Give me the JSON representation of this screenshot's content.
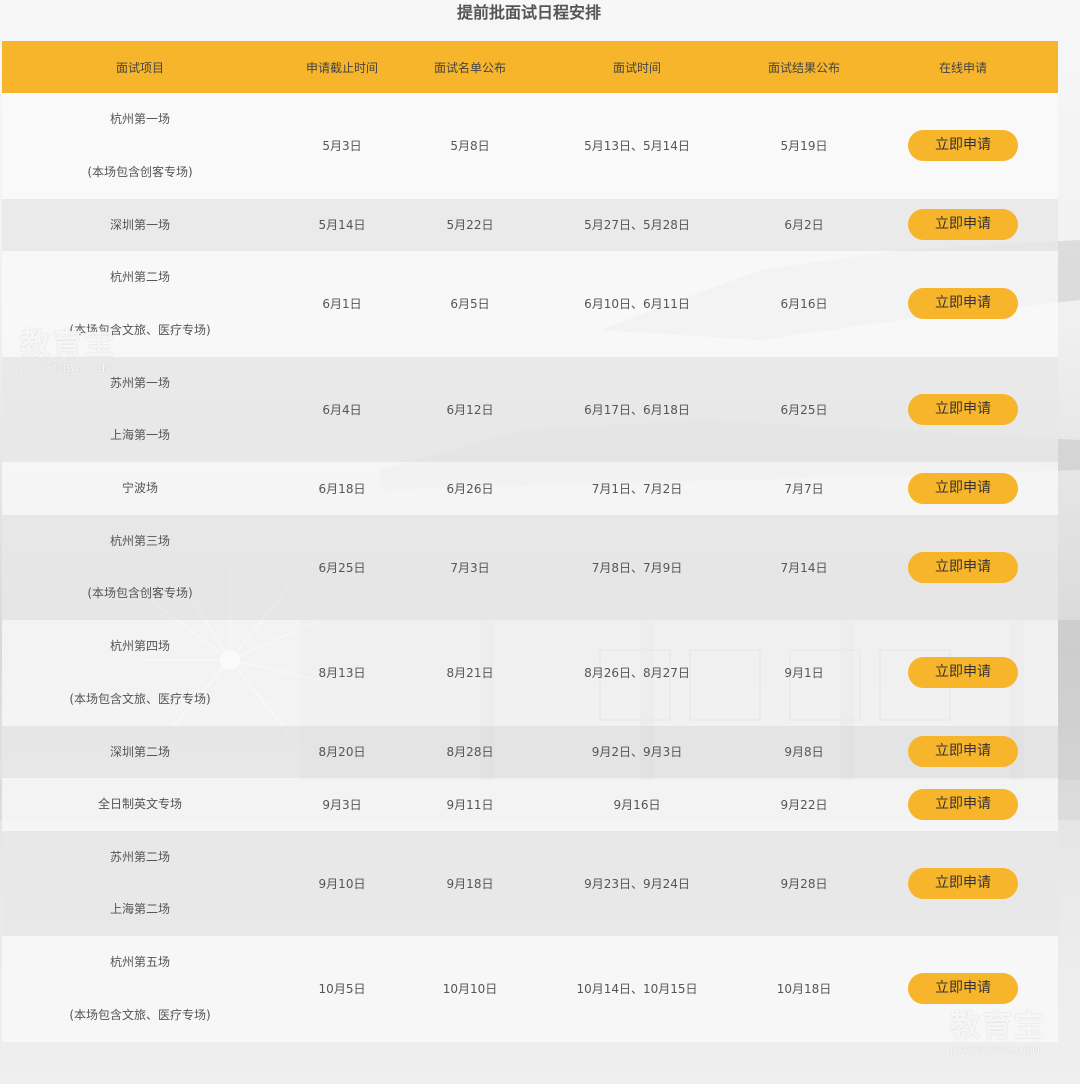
{
  "title": "提前批面试日程安排",
  "headers": [
    "面试项目",
    "申请截止时间",
    "面试名单公布",
    "面试时间",
    "面试结果公布",
    "在线申请"
  ],
  "button_label": "立即申请",
  "rows": [
    {
      "item": [
        "杭州第一场",
        "(本场包含创客专场)"
      ],
      "deadline": "5月3日",
      "list": "5月8日",
      "interview": "5月13日、5月14日",
      "result": "5月19日"
    },
    {
      "item": [
        "深圳第一场"
      ],
      "deadline": "5月14日",
      "list": "5月22日",
      "interview": "5月27日、5月28日",
      "result": "6月2日"
    },
    {
      "item": [
        "杭州第二场",
        "(本场包含文旅、医疗专场)"
      ],
      "deadline": "6月1日",
      "list": "6月5日",
      "interview": "6月10日、6月11日",
      "result": "6月16日"
    },
    {
      "item": [
        "苏州第一场",
        "上海第一场"
      ],
      "deadline": "6月4日",
      "list": "6月12日",
      "interview": "6月17日、6月18日",
      "result": "6月25日"
    },
    {
      "item": [
        "宁波场"
      ],
      "deadline": "6月18日",
      "list": "6月26日",
      "interview": "7月1日、7月2日",
      "result": "7月7日"
    },
    {
      "item": [
        "杭州第三场",
        "(本场包含创客专场)"
      ],
      "deadline": "6月25日",
      "list": "7月3日",
      "interview": "7月8日、7月9日",
      "result": "7月14日"
    },
    {
      "item": [
        "杭州第四场",
        "(本场包含文旅、医疗专场)"
      ],
      "deadline": "8月13日",
      "list": "8月21日",
      "interview": "8月26日、8月27日",
      "result": "9月1日"
    },
    {
      "item": [
        "深圳第二场"
      ],
      "deadline": "8月20日",
      "list": "8月28日",
      "interview": "9月2日、9月3日",
      "result": "9月8日"
    },
    {
      "item": [
        "全日制英文专场"
      ],
      "deadline": "9月3日",
      "list": "9月11日",
      "interview": "9月16日",
      "result": "9月22日"
    },
    {
      "item": [
        "苏州第二场",
        "上海第二场"
      ],
      "deadline": "9月10日",
      "list": "9月18日",
      "interview": "9月23日、9月24日",
      "result": "9月28日"
    },
    {
      "item": [
        "杭州第五场",
        "(本场包含文旅、医疗专场)"
      ],
      "deadline": "10月5日",
      "list": "10月10日",
      "interview": "10月14日、10月15日",
      "result": "10月18日"
    }
  ],
  "watermark": {
    "logo": "教育宝",
    "url": "JIAOYUBAO.CN"
  },
  "colors": {
    "accent": "#f7b52c",
    "row_light": "#fafafa",
    "row_dark": "#e8e8e8"
  }
}
